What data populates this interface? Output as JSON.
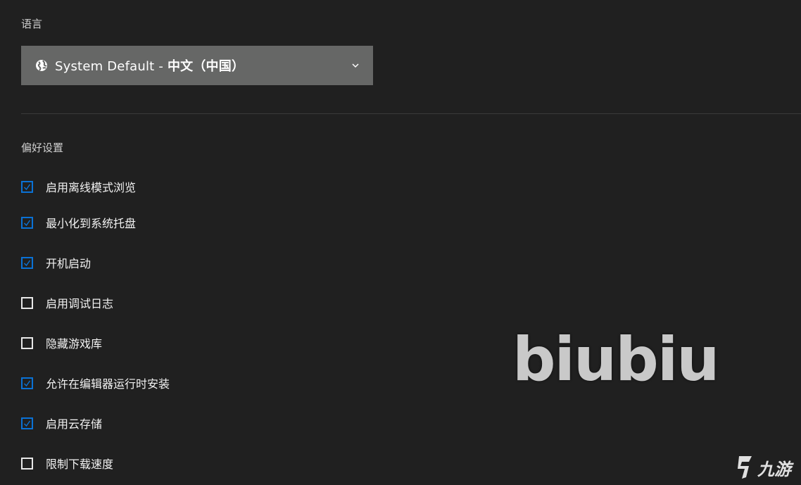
{
  "language": {
    "title": "语言",
    "select_prefix": "System Default - ",
    "select_language": "中文（中国）"
  },
  "preferences": {
    "title": "偏好设置",
    "items": [
      {
        "label": "启用离线模式浏览",
        "checked": true
      },
      {
        "label": "最小化到系统托盘",
        "checked": true
      },
      {
        "label": "开机启动",
        "checked": true
      },
      {
        "label": "启用调试日志",
        "checked": false
      },
      {
        "label": "隐藏游戏库",
        "checked": false
      },
      {
        "label": "允许在编辑器运行时安装",
        "checked": true
      },
      {
        "label": "启用云存储",
        "checked": true
      },
      {
        "label": "限制下载速度",
        "checked": false
      }
    ]
  },
  "watermark": {
    "text": "biubiu",
    "corner_logo_text": "九游"
  },
  "colors": {
    "background": "#202020",
    "select_bg": "#666766",
    "checkbox_accent": "#0a72d6"
  }
}
